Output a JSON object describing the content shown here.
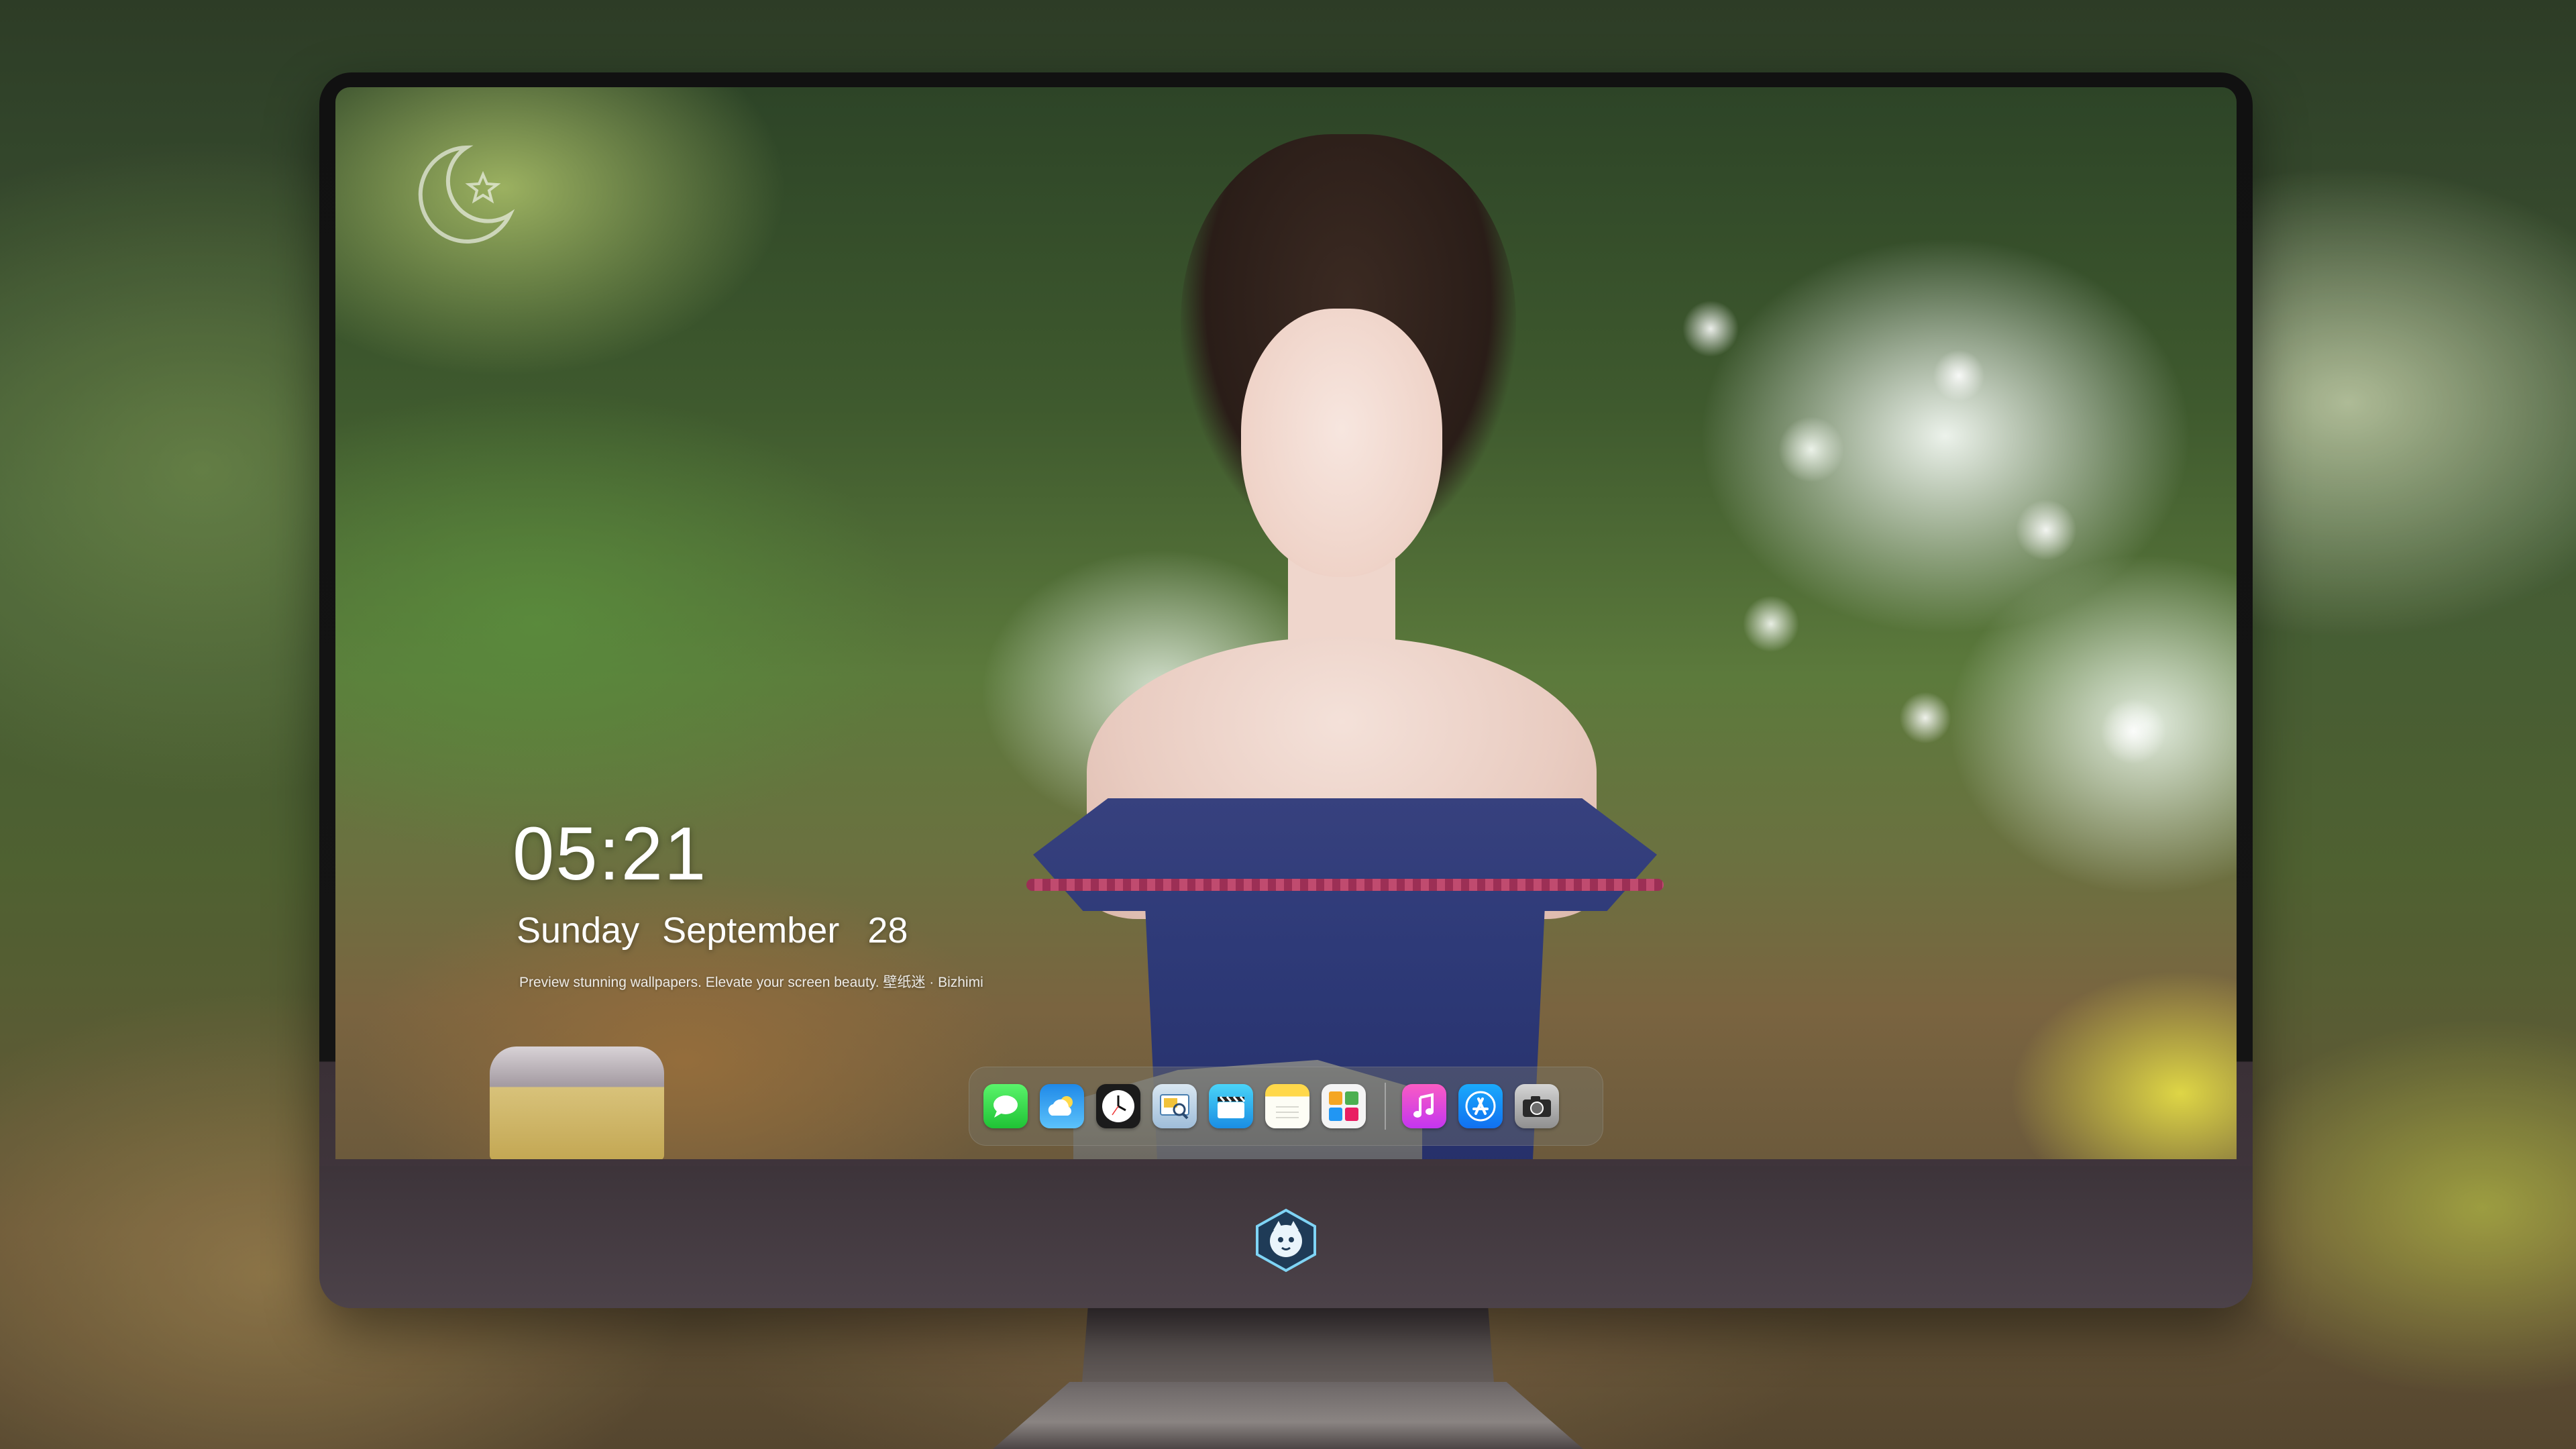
{
  "lockscreen": {
    "time": "05:21",
    "weekday": "Sunday",
    "month": "September",
    "day": "28",
    "caption": "Preview stunning wallpapers. Elevate your screen beauty. 壁纸迷 · Bizhimi"
  },
  "dock": {
    "apps": [
      {
        "name": "messages-icon"
      },
      {
        "name": "weather-icon"
      },
      {
        "name": "clock-icon"
      },
      {
        "name": "preview-icon"
      },
      {
        "name": "video-clapper-icon"
      },
      {
        "name": "notes-icon"
      },
      {
        "name": "photos-icon"
      },
      {
        "name": "music-icon"
      },
      {
        "name": "app-store-icon"
      },
      {
        "name": "camera-icon"
      }
    ]
  },
  "monitor": {
    "chin_logo": "mascot-logo-icon",
    "wallpaper_watermark": "moon-logo-icon"
  }
}
